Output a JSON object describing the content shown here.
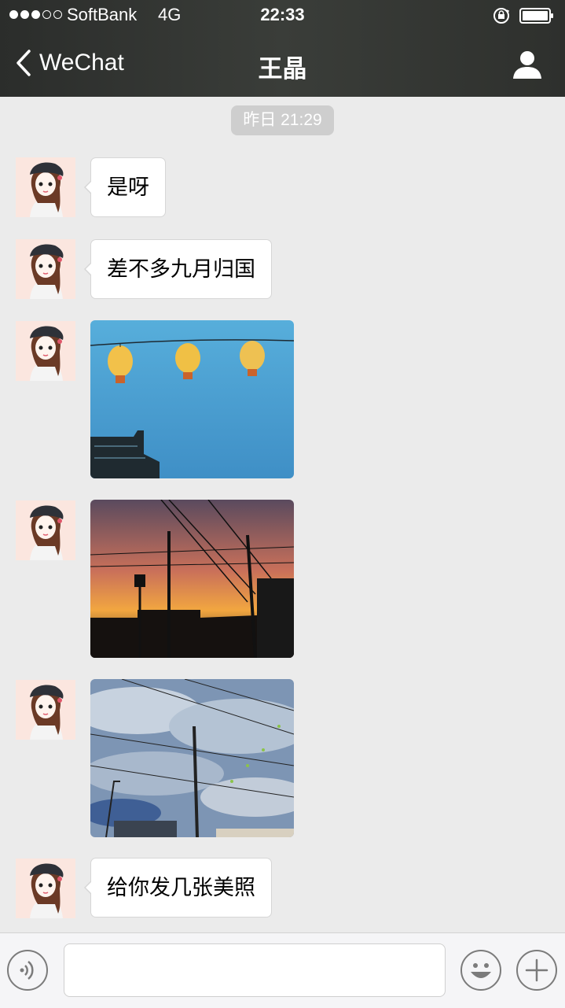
{
  "status_bar": {
    "carrier": "SoftBank",
    "network": "4G",
    "time": "22:33",
    "signal_bars_filled": 3,
    "signal_bars_total": 5,
    "battery_level": 1.0
  },
  "nav": {
    "back_label": "WeChat",
    "title": "王晶",
    "back_icon": "chevron-left-icon",
    "profile_icon": "person-icon"
  },
  "chat": {
    "timestamp": "昨日 21:29",
    "messages": [
      {
        "type": "text",
        "text": "是呀"
      },
      {
        "type": "text",
        "text": "差不多九月归国"
      },
      {
        "type": "image",
        "description_icon": "photo-lanterns"
      },
      {
        "type": "image",
        "description_icon": "photo-sunset"
      },
      {
        "type": "image",
        "description_icon": "photo-cloudy-sky"
      },
      {
        "type": "text",
        "text": "给你发几张美照"
      }
    ]
  },
  "input_bar": {
    "voice_icon": "voice-icon",
    "emoji_icon": "emoji-icon",
    "more_icon": "plus-icon",
    "text_value": ""
  },
  "colors": {
    "header_bg": "#353734",
    "chat_bg": "#ebebeb",
    "bubble_bg": "#ffffff",
    "timestamp_bg": "#cecece"
  }
}
